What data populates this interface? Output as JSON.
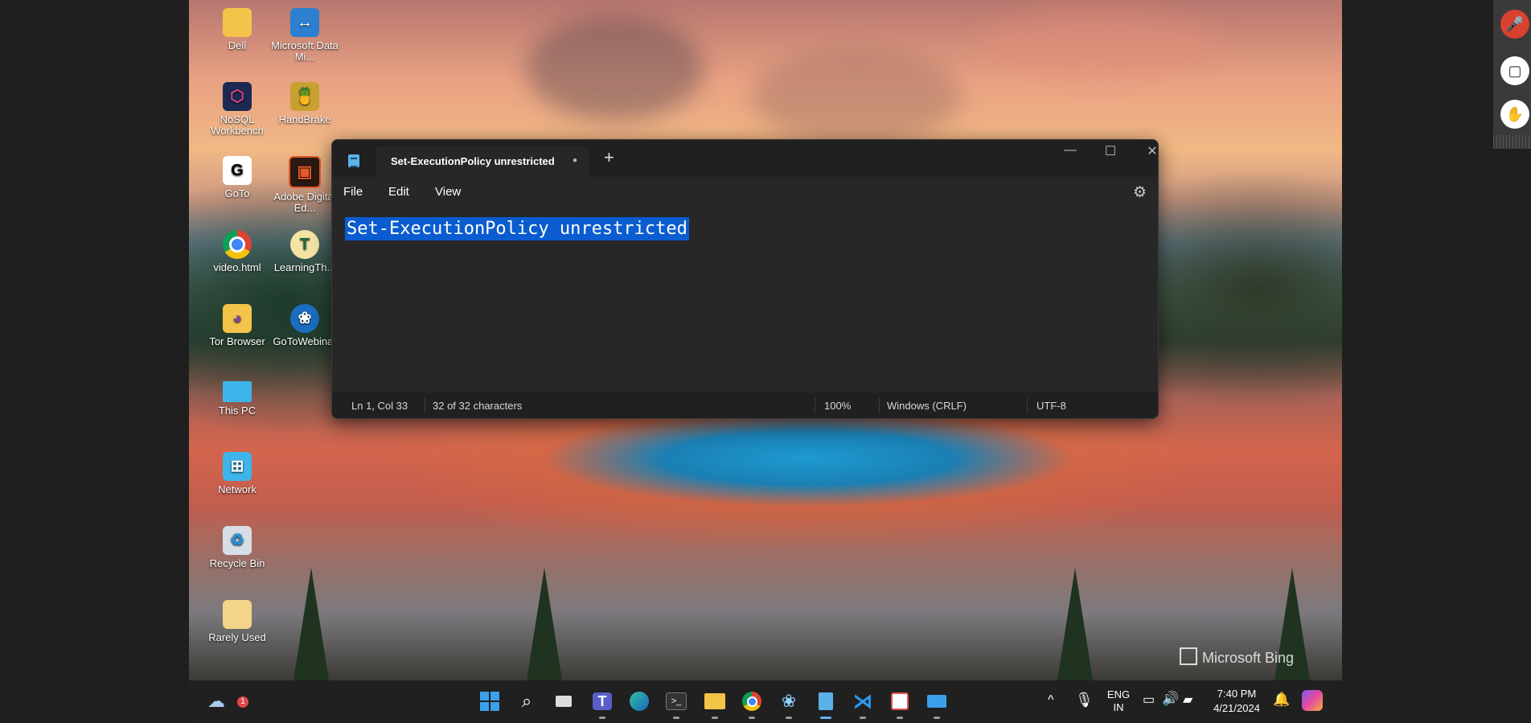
{
  "desktop": {
    "icons": [
      {
        "label": "Dell",
        "icon": "folder-icon"
      },
      {
        "label": "Microsoft Data Mi...",
        "icon": "data-migration-icon"
      },
      {
        "label": "NoSQL Workbench",
        "icon": "nosql-workbench-icon"
      },
      {
        "label": "HandBrake",
        "icon": "handbrake-icon"
      },
      {
        "label": "GoTo",
        "icon": "goto-icon"
      },
      {
        "label": "Adobe Digital Ed...",
        "icon": "adobe-digital-editions-icon"
      },
      {
        "label": "video.html",
        "icon": "chrome-icon"
      },
      {
        "label": "LearningTh...",
        "icon": "learningthings-icon"
      },
      {
        "label": "Tor Browser",
        "icon": "tor-browser-icon"
      },
      {
        "label": "GoToWebinar",
        "icon": "gotowebinar-icon"
      },
      {
        "label": "This PC",
        "icon": "this-pc-icon"
      },
      {
        "label": "Network",
        "icon": "network-icon"
      },
      {
        "label": "Recycle Bin",
        "icon": "recycle-bin-icon"
      },
      {
        "label": "Rarely Used",
        "icon": "folder-icon"
      }
    ],
    "watermark": "Microsoft Bing"
  },
  "notepad": {
    "tab_title": "Set-ExecutionPolicy unrestricted",
    "tab_unsaved_dot": "●",
    "new_tab": "+",
    "window_controls": {
      "minimize": "—",
      "maximize": "☐",
      "close": "✕"
    },
    "menu": {
      "file": "File",
      "edit": "Edit",
      "view": "View"
    },
    "settings_icon": "⚙",
    "content": "Set-ExecutionPolicy unrestricted",
    "status": {
      "position": "Ln 1, Col 33",
      "chars": "32 of 32 characters",
      "zoom": "100%",
      "line_ending": "Windows (CRLF)",
      "encoding": "UTF-8"
    }
  },
  "taskbar": {
    "weather_badge": "1",
    "apps": [
      "start-icon",
      "search-icon",
      "task-view-icon",
      "teams-icon",
      "edge-icon",
      "terminal-icon",
      "file-explorer-icon",
      "chrome-icon",
      "gotowebinar-icon",
      "notepad-icon",
      "vscode-icon",
      "snipping-tool-icon",
      "remote-desktop-icon"
    ],
    "tray": {
      "lang_top": "ENG",
      "lang_bottom": "IN",
      "time": "7:40 PM",
      "date": "4/21/2024"
    }
  },
  "side_panel": {
    "buttons": [
      "mute-mic-icon",
      "window-icon",
      "raise-hand-icon"
    ]
  },
  "colors": {
    "accent": "#0a5ccf",
    "titlebar": "#202020",
    "editor_bg": "#272727",
    "taskbar": "#202020"
  }
}
